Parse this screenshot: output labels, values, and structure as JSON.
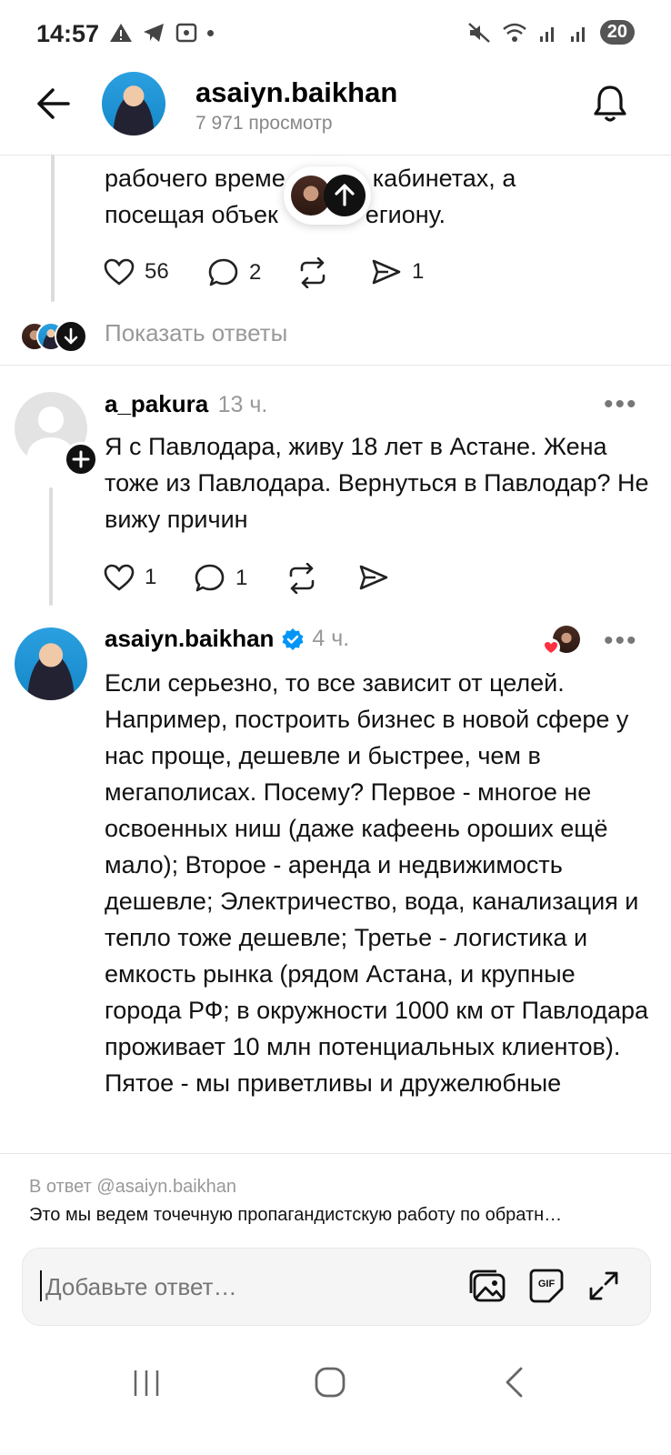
{
  "status_bar": {
    "time": "14:57",
    "battery": "20"
  },
  "header": {
    "username": "asaiyn.baikhan",
    "views": "7 971 просмотр"
  },
  "post_top": {
    "text_line1": "рабочего време",
    "text_line1b": "кабинетах, а",
    "text_line2": "посещая объек",
    "text_line2b": "егиону.",
    "likes": "56",
    "comments": "2",
    "shares": "1"
  },
  "show_replies": "Показать ответы",
  "comment1": {
    "username": "a_pakura",
    "time": "13 ч.",
    "text": "Я с Павлодара, живу 18 лет в Астане. Жена тоже из Павлодара. Вернуться в Павлодар? Не вижу причин",
    "likes": "1",
    "comments": "1"
  },
  "comment2": {
    "username": "asaiyn.baikhan",
    "time": "4 ч.",
    "text": "Если серьезно, то все зависит от целей. Например, построить бизнес в новой сфере у нас проще, дешевле и быстрее, чем в мегаполисах. Посему? Первое - многое не освоенных ниш (даже кафеень ороших ещё мало); Второе - аренда и недвижимость дешевле; Электричество, вода, канализация и тепло тоже дешевле; Третье - логистика и емкость рынка (рядом Астана, и крупные города РФ; в окружности 1000 км от Павлодара проживает 10 млн потенциальных клиентов). Пятое - мы приветливы и дружелюбные"
  },
  "reply_to": {
    "label": "В ответ @asaiyn.baikhan",
    "preview": "Это мы ведем точечную  пропагандистскую работу по обратн…"
  },
  "composer": {
    "placeholder": "Добавьте ответ…"
  },
  "colors": {
    "verified": "#0095f6",
    "heart_badge": "#ff3040",
    "muted": "#999999"
  }
}
